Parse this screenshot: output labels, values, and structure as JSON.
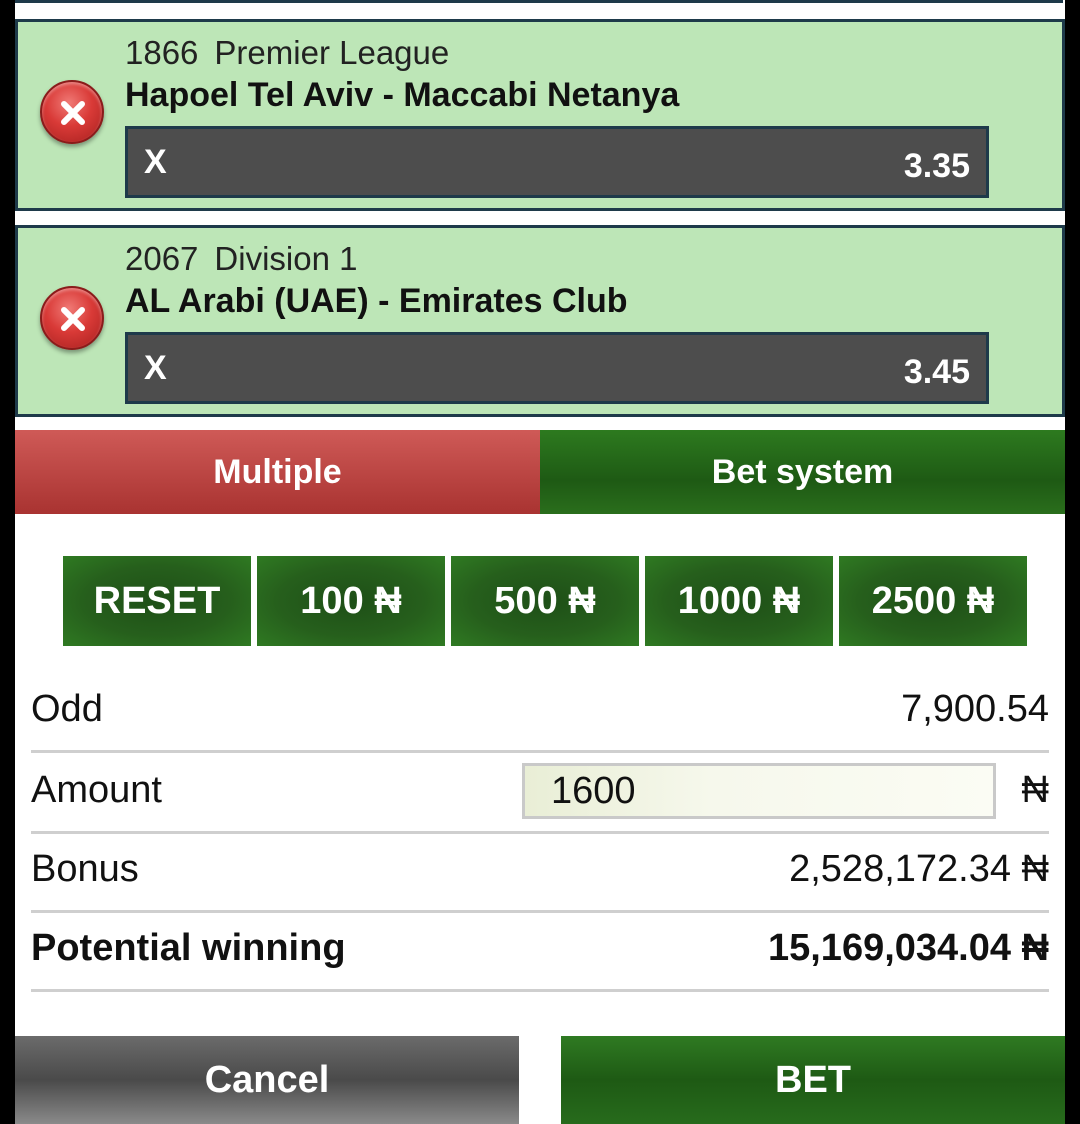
{
  "matches": [
    {
      "code": "1866",
      "league": "Premier League",
      "teams": "Hapoel Tel Aviv - Maccabi Netanya",
      "pick": "X",
      "odds": "3.35"
    },
    {
      "code": "2067",
      "league": "Division 1",
      "teams": "AL Arabi (UAE) - Emirates Club",
      "pick": "X",
      "odds": "3.45"
    }
  ],
  "tabs": {
    "multiple": "Multiple",
    "bet_system": "Bet system"
  },
  "stakes": [
    "RESET",
    "100 ₦",
    "500 ₦",
    "1000 ₦",
    "2500 ₦"
  ],
  "summary": {
    "odd_label": "Odd",
    "odd_value": "7,900.54",
    "amount_label": "Amount",
    "amount_value": "1600",
    "currency": "₦",
    "bonus_label": "Bonus",
    "bonus_value": "2,528,172.34 ₦",
    "winning_label": "Potential winning",
    "winning_value": "15,169,034.04 ₦"
  },
  "actions": {
    "cancel": "Cancel",
    "bet": "BET"
  },
  "colors": {
    "match_bg": "#bde6b7",
    "border": "#1e3a4a",
    "pick_bar": "#4d4d4d",
    "tab_active": "#b83c3a",
    "green": "#1e5a14",
    "cancel": "#5a5a5a"
  }
}
